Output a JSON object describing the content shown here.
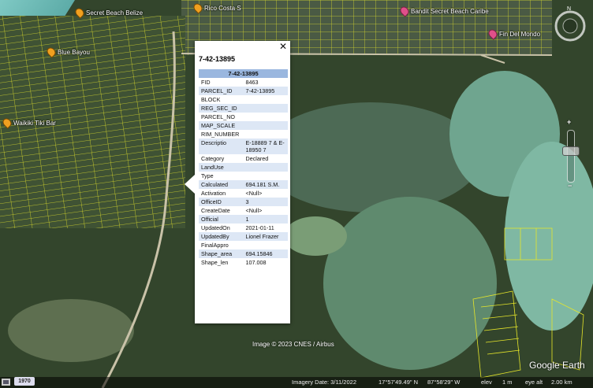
{
  "map": {
    "pois": [
      {
        "name": "Secret Beach Belize",
        "color": "orange"
      },
      {
        "name": "Blue Bayou",
        "color": "orange"
      },
      {
        "name": "Waikiki Tiki Bar",
        "color": "orange"
      },
      {
        "name": "Rico Costa S",
        "color": "orange"
      },
      {
        "name": "Bandit Secret Beach Caribe",
        "color": "pink"
      },
      {
        "name": "Fin Del Mondo",
        "color": "pink"
      }
    ],
    "copyright": "Image © 2023 CNES / Airbus"
  },
  "popup": {
    "title": "7-42-13895",
    "close_label": "✕",
    "table_header": "7-42-13895",
    "rows": [
      {
        "k": "FID",
        "v": "8463"
      },
      {
        "k": "PARCEL_ID",
        "v": "7-42-13895"
      },
      {
        "k": "BLOCK",
        "v": ""
      },
      {
        "k": "REG_SEC_ID",
        "v": ""
      },
      {
        "k": "PARCEL_NO",
        "v": ""
      },
      {
        "k": "MAP_SCALE",
        "v": ""
      },
      {
        "k": "RIM_NUMBER",
        "v": ""
      },
      {
        "k": "Descriptio",
        "v": "E-18889 7 & E-18950 7"
      },
      {
        "k": "Category",
        "v": "Declared"
      },
      {
        "k": "LandUse",
        "v": ""
      },
      {
        "k": "Type",
        "v": ""
      },
      {
        "k": "Calculated",
        "v": "694.181 S.M."
      },
      {
        "k": "Activation",
        "v": "<Null>"
      },
      {
        "k": "OfficeID",
        "v": "3"
      },
      {
        "k": "CreateDate",
        "v": "<Null>"
      },
      {
        "k": "Official",
        "v": "1"
      },
      {
        "k": "UpdatedOn",
        "v": "2021-01-11"
      },
      {
        "k": "UpdatedBy",
        "v": "Lionel Frazer"
      },
      {
        "k": "FinalAppro",
        "v": ""
      },
      {
        "k": "Shape_area",
        "v": "694.15846"
      },
      {
        "k": "Shape_len",
        "v": "107.008"
      }
    ]
  },
  "nav": {
    "north": "N",
    "zoom_plus": "+",
    "zoom_minus": "−"
  },
  "status": {
    "year": "1970",
    "imagery_date": "Imagery Date: 3/11/2022",
    "lat": "17°57'49.49\" N",
    "lon": "87°58'29\" W",
    "elev_label": "elev",
    "elev": "1 m",
    "eye_alt_label": "eye alt",
    "eye_alt": "2.00 km"
  },
  "brand": {
    "logo": "Google Earth"
  },
  "colors": {
    "parcel_lines": "#e6e62a",
    "header_blue": "#9ab7df",
    "row_alt": "#dde7f5"
  }
}
